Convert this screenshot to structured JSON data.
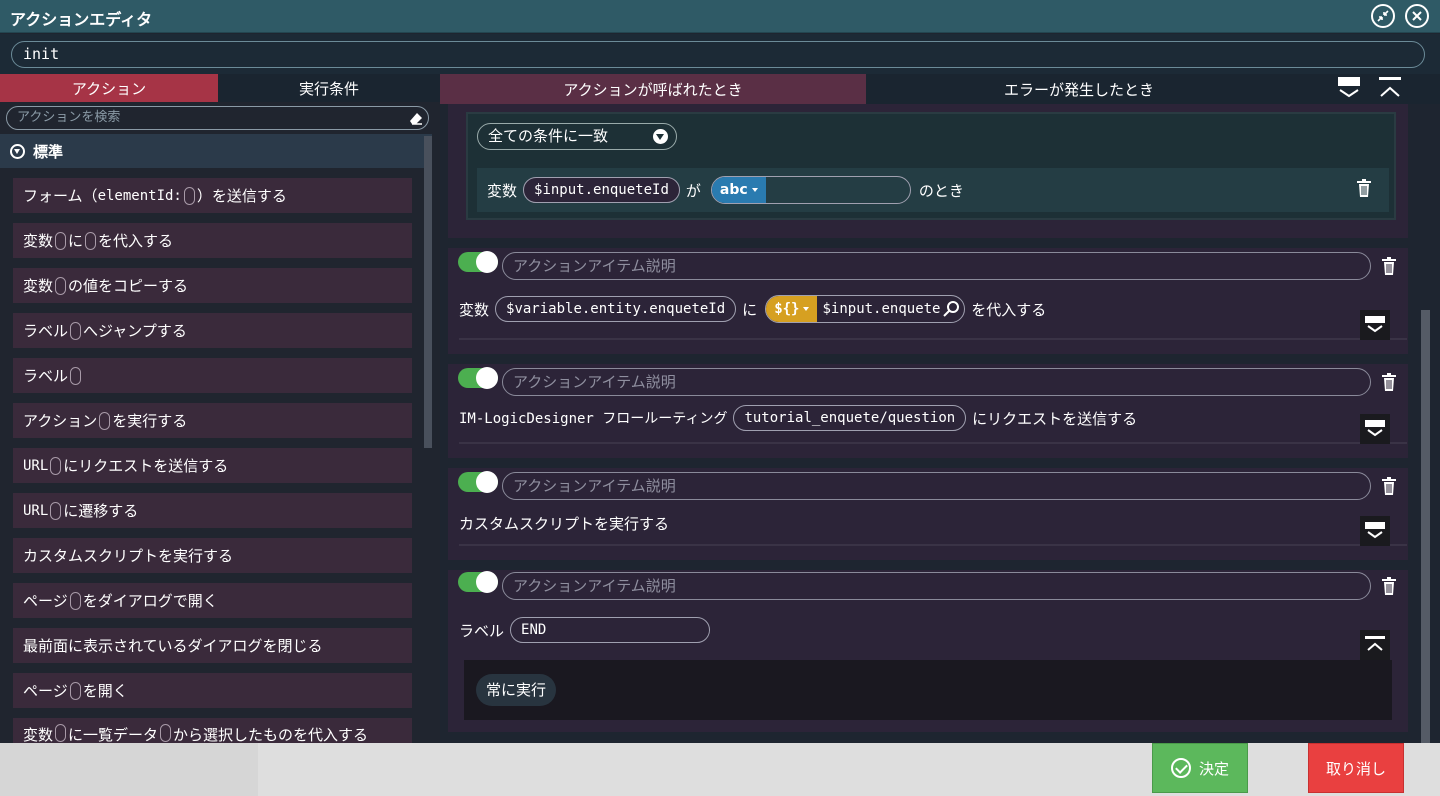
{
  "window": {
    "title": "アクションエディタ"
  },
  "action_name": "init",
  "left_tabs": [
    "アクション",
    "実行条件"
  ],
  "search": {
    "placeholder": "アクションを検索"
  },
  "category": "標準",
  "library": [
    [
      "フォーム（",
      "elementId:",
      "）を送信する"
    ],
    [
      "変数",
      "に",
      "を代入する"
    ],
    [
      "変数",
      "の値をコピーする"
    ],
    [
      "ラベル",
      "へジャンプする"
    ],
    [
      "ラベル"
    ],
    [
      "アクション",
      "を実行する"
    ],
    [
      "URL",
      "にリクエストを送信する"
    ],
    [
      "URL",
      "に遷移する"
    ],
    [
      "カスタムスクリプトを実行する"
    ],
    [
      "ページ",
      "をダイアログで開く"
    ],
    [
      "最前面に表示されているダイアログを閉じる"
    ],
    [
      "ページ",
      "を開く"
    ],
    [
      "変数",
      "に一覧データ",
      "から選択したものを代入する"
    ]
  ],
  "right_tabs": [
    "アクションが呼ばれたとき",
    "エラーが発生したとき"
  ],
  "condition": {
    "match": "全ての条件に一致",
    "var_label": "変数",
    "var_value": "$input.enqueteId",
    "ga": "が",
    "type": "abc",
    "value": "",
    "tail": "のとき"
  },
  "desc_placeholder": "アクションアイテム説明",
  "items": {
    "assign": {
      "var_label": "変数",
      "var": "$variable.entity.enqueteId",
      "ni": "に",
      "type": "${}",
      "value": "$input.enquete",
      "tail": "を代入する"
    },
    "request": {
      "prefix": "IM-LogicDesigner フロールーティング",
      "route": "tutorial_enquete/question",
      "tail": "にリクエストを送信する"
    },
    "script": {
      "text": "カスタムスクリプトを実行する"
    },
    "label": {
      "prefix": "ラベル",
      "value": "END",
      "always": "常に実行"
    }
  },
  "footer": {
    "ok": "決定",
    "cancel": "取り消し"
  },
  "colors": {
    "accent_red": "#a63446",
    "toggle_on": "#4caf50",
    "ok": "#5cb85c",
    "cancel": "#e94040",
    "type_abc": "#2a7bb0",
    "type_expr": "#d6a021"
  }
}
